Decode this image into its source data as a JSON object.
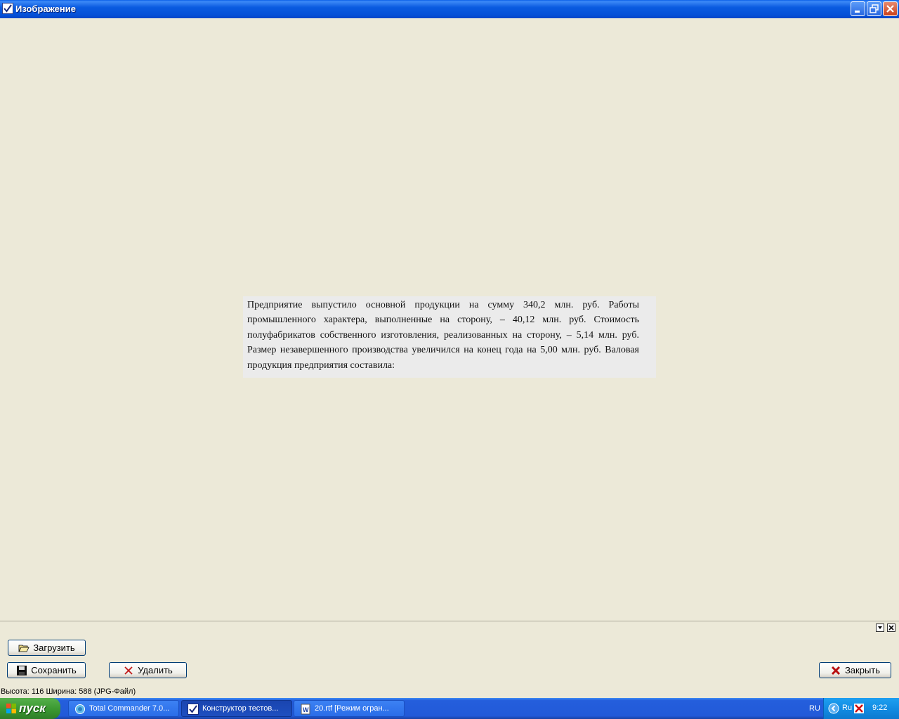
{
  "window": {
    "title": "Изображение"
  },
  "image": {
    "text": "Предприятие выпустило основной продукции на сумму 340,2 млн. руб. Работы промышленного характера, выполненные на сторону, – 40,12 млн. руб. Стоимость полуфабрикатов собственного изготовления, реализованных на сторону, – 5,14 млн. руб. Размер незавершенного производства увеличился на конец года на 5,00 млн. руб. Валовая продукция предприятия составила:"
  },
  "panel": {
    "load_label": "Загрузить",
    "save_label": "Сохранить",
    "delete_label": "Удалить",
    "close_label": "Закрыть"
  },
  "status": {
    "text": "Высота: 116  Ширина: 588  (JPG-Файл)"
  },
  "taskbar": {
    "start_label": "пуск",
    "tasks": [
      {
        "label": "Total Commander 7.0..."
      },
      {
        "label": "Конструктор тестов..."
      },
      {
        "label": "20.rtf [Режим огран..."
      }
    ],
    "language": "RU",
    "tray_lang": "Ru",
    "clock": "9:22"
  }
}
